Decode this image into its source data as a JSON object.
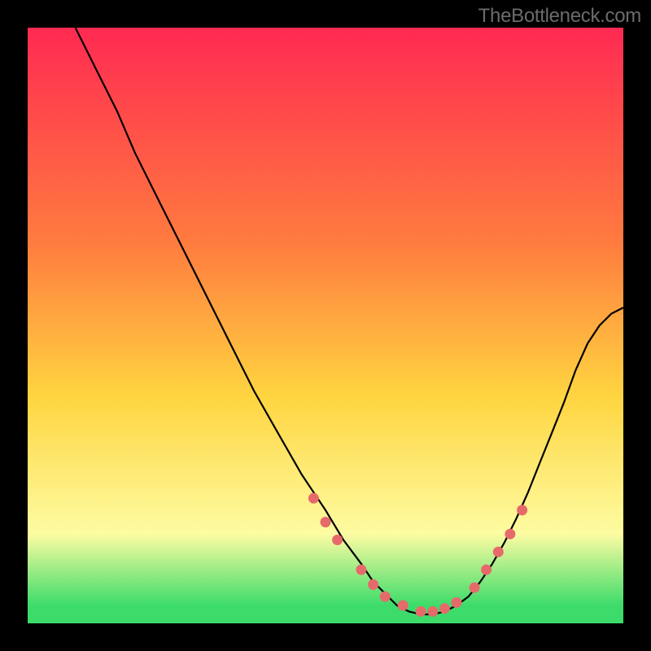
{
  "watermark": "TheBottleneck.com",
  "colors": {
    "bg": "#000000",
    "grad_top": "#ff2a52",
    "grad_mid1": "#ff7b3f",
    "grad_mid2": "#ffd540",
    "grad_mid3": "#fdfca2",
    "grad_bot": "#3ddc6a",
    "curve": "#000000",
    "dots": "#e76a6b"
  },
  "chart_data": {
    "type": "line",
    "title": "",
    "xlabel": "",
    "ylabel": "",
    "xlim": [
      0,
      100
    ],
    "ylim": [
      0,
      100
    ],
    "series": [
      {
        "name": "bottleneck-curve",
        "x": [
          8,
          10,
          12,
          15,
          18,
          22,
          26,
          30,
          34,
          38,
          42,
          46,
          50,
          53,
          56,
          58,
          60,
          62,
          64,
          66,
          68,
          70,
          72,
          74,
          76,
          78,
          80,
          82,
          84,
          86,
          88,
          90,
          92,
          94,
          96,
          98,
          100
        ],
        "y": [
          100,
          96,
          92,
          86,
          79,
          71,
          63,
          55,
          47,
          39,
          32,
          25,
          19,
          14,
          10,
          7,
          5,
          3,
          2,
          1.5,
          1.5,
          2,
          3,
          4.5,
          7,
          10,
          13.5,
          17.5,
          22,
          27,
          32,
          37,
          42.5,
          47,
          50,
          52,
          53
        ]
      }
    ],
    "dots": {
      "name": "sample-points",
      "x": [
        48,
        50,
        52,
        56,
        58,
        60,
        63,
        66,
        68,
        70,
        72,
        75,
        77,
        79,
        81,
        83
      ],
      "y": [
        21,
        17,
        14,
        9,
        6.5,
        4.5,
        3,
        2,
        2,
        2.5,
        3.5,
        6,
        9,
        12,
        15,
        19
      ]
    }
  }
}
